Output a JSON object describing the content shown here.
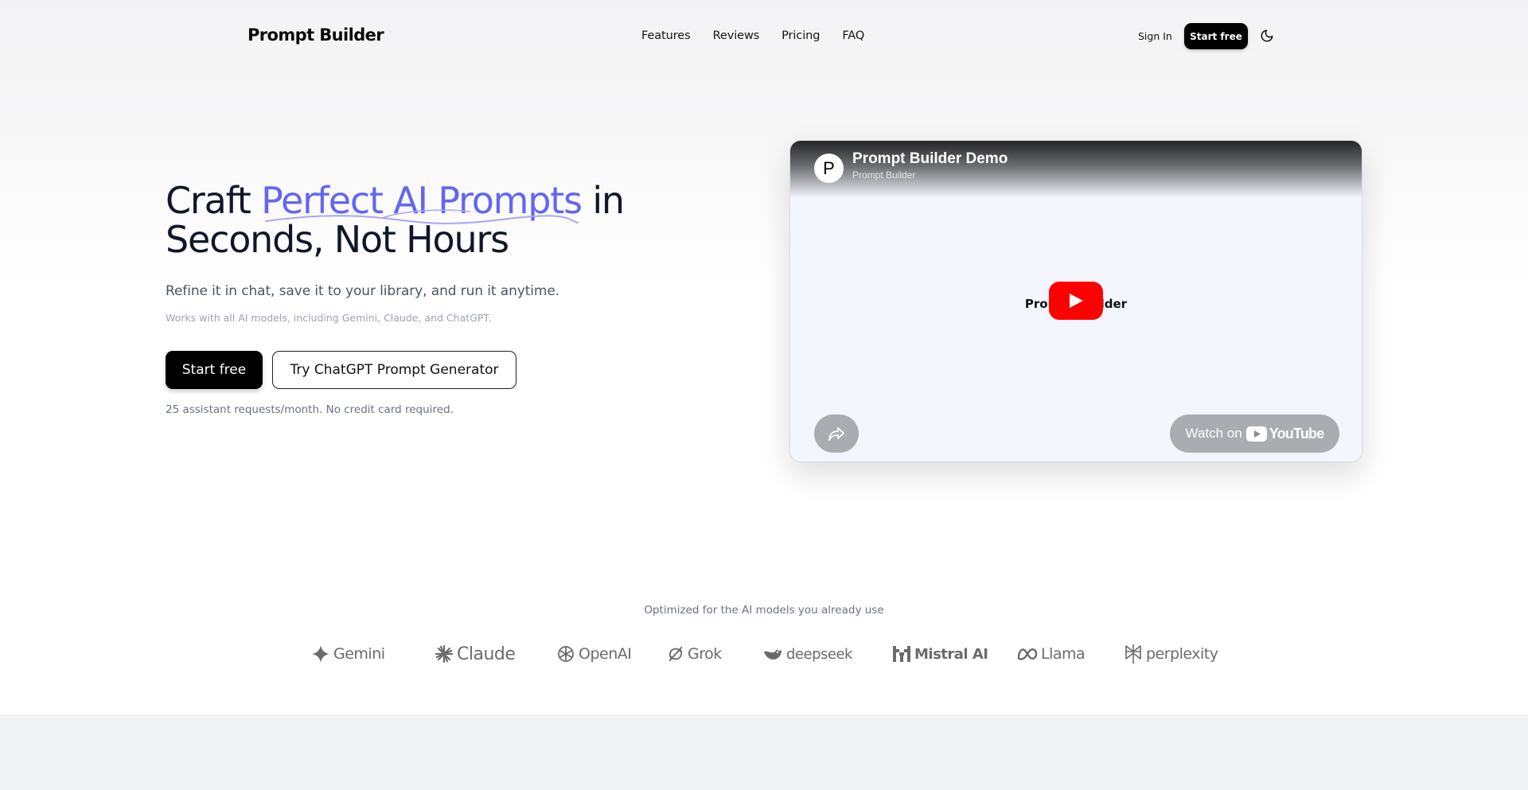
{
  "nav": {
    "logo": "Prompt Builder",
    "links": [
      "Features",
      "Reviews",
      "Pricing",
      "FAQ"
    ],
    "sign_in": "Sign In",
    "start_free": "Start free",
    "theme_icon": "moon-icon"
  },
  "hero": {
    "title_part1": "Craft ",
    "title_accent": "Perfect AI Prompts",
    "title_part2": " in Seconds, Not Hours",
    "subtitle": "Refine it in chat, save it to your library, and run it anytime.",
    "note": "Works with all AI models, including Gemini, Claude, and ChatGPT.",
    "primary_button": "Start free",
    "secondary_button": "Try ChatGPT Prompt Generator",
    "fine_print": "25 assistant requests/month. No credit card required.",
    "accent_color": "#6366f1"
  },
  "video": {
    "avatar_letter": "P",
    "title": "Prompt Builder Demo",
    "channel": "Prompt Builder",
    "center_text": "Prompt Builder",
    "watch_on": "Watch on",
    "youtube_word": "YouTube",
    "play_color": "#ff0000"
  },
  "models": {
    "caption": "Optimized for the AI models you already use",
    "items": [
      {
        "name": "Gemini",
        "icon": "gemini-icon"
      },
      {
        "name": "Claude",
        "icon": "claude-icon"
      },
      {
        "name": "OpenAI",
        "icon": "openai-icon"
      },
      {
        "name": "Grok",
        "icon": "grok-icon"
      },
      {
        "name": "deepseek",
        "icon": "deepseek-icon"
      },
      {
        "name": "Mistral AI",
        "icon": "mistral-icon"
      },
      {
        "name": "Llama",
        "icon": "meta-icon"
      },
      {
        "name": "perplexity",
        "icon": "perplexity-icon"
      }
    ]
  }
}
